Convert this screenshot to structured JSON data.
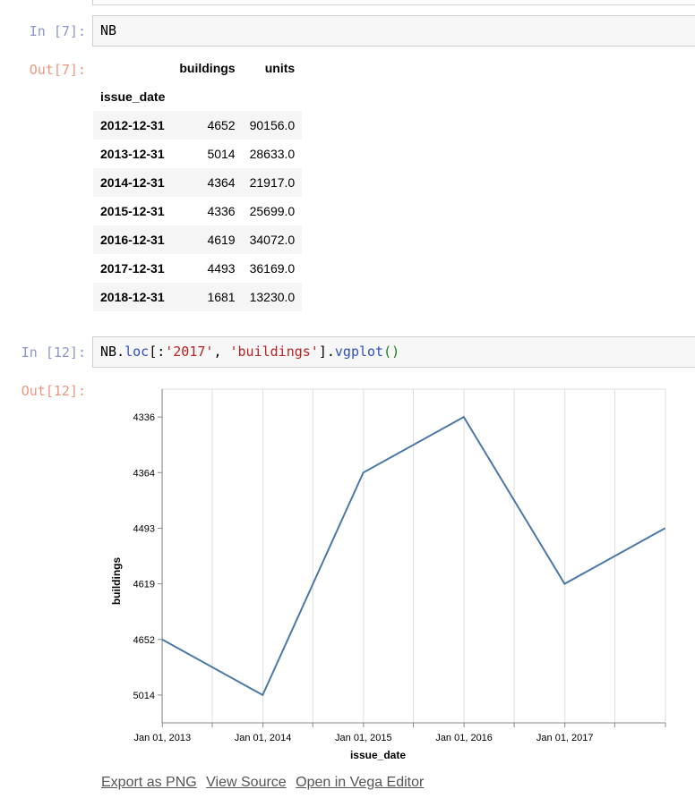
{
  "cells": [
    {
      "in_prompt": "In [7]:",
      "out_prompt": "Out[7]:",
      "code": "NB"
    },
    {
      "in_prompt": "In [12]:",
      "out_prompt": "Out[12]:",
      "code_parts": {
        "p1": "NB",
        "p2": ".",
        "p3": "loc",
        "p4": "[:",
        "p5": "'2017'",
        "p6": ", ",
        "p7": "'buildings'",
        "p8": "].",
        "p9": "vgplot",
        "p10": "()"
      }
    }
  ],
  "table": {
    "columns": [
      "buildings",
      "units"
    ],
    "index_name": "issue_date",
    "rows": [
      {
        "date": "2012-12-31",
        "buildings": "4652",
        "units": "90156.0"
      },
      {
        "date": "2013-12-31",
        "buildings": "5014",
        "units": "28633.0"
      },
      {
        "date": "2014-12-31",
        "buildings": "4364",
        "units": "21917.0"
      },
      {
        "date": "2015-12-31",
        "buildings": "4336",
        "units": "25699.0"
      },
      {
        "date": "2016-12-31",
        "buildings": "4619",
        "units": "34072.0"
      },
      {
        "date": "2017-12-31",
        "buildings": "4493",
        "units": "36169.0"
      },
      {
        "date": "2018-12-31",
        "buildings": "1681",
        "units": "13230.0"
      }
    ]
  },
  "chart_data": {
    "type": "line",
    "xlabel": "issue_date",
    "ylabel": "buildings",
    "x_tick_labels": [
      "Jan 01, 2013",
      "Jan 01, 2014",
      "Jan 01, 2015",
      "Jan 01, 2016",
      "Jan 01, 2017"
    ],
    "y_categories": [
      "4336",
      "4364",
      "4493",
      "4619",
      "4652",
      "5014"
    ],
    "x_domain": [
      "2012-12-31",
      "2018-01-01"
    ],
    "grid": true,
    "color": "#4c78a8",
    "series": [
      {
        "points": [
          {
            "x": "2012-12-31",
            "y": "4652"
          },
          {
            "x": "2013-12-31",
            "y": "5014"
          },
          {
            "x": "2014-12-31",
            "y": "4364"
          },
          {
            "x": "2015-12-31",
            "y": "4336"
          },
          {
            "x": "2016-12-31",
            "y": "4619"
          },
          {
            "x": "2017-12-31",
            "y": "4493"
          }
        ]
      }
    ]
  },
  "actions": [
    "Export as PNG",
    "View Source",
    "Open in Vega Editor"
  ]
}
